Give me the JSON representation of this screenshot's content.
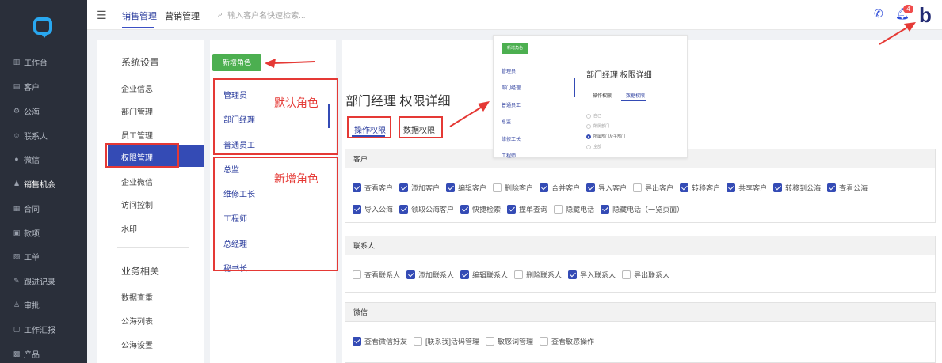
{
  "sidebar": {
    "items": [
      {
        "label": "工作台",
        "icon": "dashboard-icon"
      },
      {
        "label": "客户",
        "icon": "customer-icon"
      },
      {
        "label": "公海",
        "icon": "public-pool-icon"
      },
      {
        "label": "联系人",
        "icon": "contact-icon"
      },
      {
        "label": "微信",
        "icon": "wechat-icon"
      },
      {
        "label": "销售机会",
        "icon": "opportunity-icon"
      },
      {
        "label": "合同",
        "icon": "contract-icon"
      },
      {
        "label": "款项",
        "icon": "payment-icon"
      },
      {
        "label": "工单",
        "icon": "ticket-icon"
      },
      {
        "label": "跟进记录",
        "icon": "followup-icon"
      },
      {
        "label": "审批",
        "icon": "approval-icon"
      },
      {
        "label": "工作汇报",
        "icon": "report-icon"
      },
      {
        "label": "产品",
        "icon": "product-icon"
      }
    ]
  },
  "header": {
    "tabs": [
      "销售管理",
      "营销管理"
    ],
    "search_placeholder": "输入客户名快速检索...",
    "notification_count": "4",
    "brand_letter": "b"
  },
  "settings_nav": {
    "section1_title": "系统设置",
    "section1_items": [
      "企业信息",
      "部门管理",
      "员工管理",
      "权限管理",
      "企业微信",
      "访问控制",
      "水印"
    ],
    "section2_title": "业务相关",
    "section2_items": [
      "数据查重",
      "公海列表",
      "公海设置"
    ]
  },
  "roles": {
    "add_button": "新增角色",
    "default_roles": [
      "管理员",
      "部门经理",
      "普通员工"
    ],
    "custom_roles": [
      "总监",
      "维修工长",
      "工程师",
      "总经理",
      "秘书长"
    ]
  },
  "main": {
    "title": "部门经理 权限详细",
    "tabs": [
      "操作权限",
      "数据权限"
    ]
  },
  "groups": [
    {
      "title": "客户",
      "perms": [
        {
          "label": "查看客户",
          "checked": true
        },
        {
          "label": "添加客户",
          "checked": true
        },
        {
          "label": "编辑客户",
          "checked": true
        },
        {
          "label": "删除客户",
          "checked": false
        },
        {
          "label": "合并客户",
          "checked": true
        },
        {
          "label": "导入客户",
          "checked": true
        },
        {
          "label": "导出客户",
          "checked": false
        },
        {
          "label": "转移客户",
          "checked": true
        },
        {
          "label": "共享客户",
          "checked": true
        },
        {
          "label": "转移到公海",
          "checked": true
        },
        {
          "label": "查看公海",
          "checked": true
        },
        {
          "label": "导入公海",
          "checked": true
        },
        {
          "label": "领取公海客户",
          "checked": true
        },
        {
          "label": "快捷检索",
          "checked": true
        },
        {
          "label": "撞单查询",
          "checked": true
        },
        {
          "label": "隐藏电话",
          "checked": false
        },
        {
          "label": "隐藏电话（一览页面）",
          "checked": true
        }
      ]
    },
    {
      "title": "联系人",
      "perms": [
        {
          "label": "查看联系人",
          "checked": false
        },
        {
          "label": "添加联系人",
          "checked": true
        },
        {
          "label": "编辑联系人",
          "checked": true
        },
        {
          "label": "删除联系人",
          "checked": false
        },
        {
          "label": "导入联系人",
          "checked": true
        },
        {
          "label": "导出联系人",
          "checked": false
        }
      ]
    },
    {
      "title": "微信",
      "perms": [
        {
          "label": "查看微信好友",
          "checked": true
        },
        {
          "label": "[联系我]活码管理",
          "checked": false
        },
        {
          "label": "敏感词管理",
          "checked": false
        },
        {
          "label": "查看敏感操作",
          "checked": false
        }
      ]
    }
  ],
  "annotations": {
    "default_roles_label": "默认角色",
    "new_roles_label": "新增角色",
    "color": "#e53935"
  },
  "inset": {
    "add_button": "新增角色",
    "roles": [
      "管理员",
      "部门经理",
      "普通员工",
      "总监",
      "维修工长",
      "工程师"
    ],
    "title": "部门经理 权限详细",
    "tabs": [
      "操作权限",
      "数据权限"
    ],
    "options": [
      {
        "label": "自己",
        "selected": false
      },
      {
        "label": "所属部门",
        "selected": false
      },
      {
        "label": "所属部门及子部门",
        "selected": true
      },
      {
        "label": "全部",
        "selected": false
      }
    ]
  },
  "colors": {
    "accent": "#344bb5",
    "sidebar": "#2a2f3a",
    "green": "#4caf50",
    "badge": "#f04c4c"
  }
}
